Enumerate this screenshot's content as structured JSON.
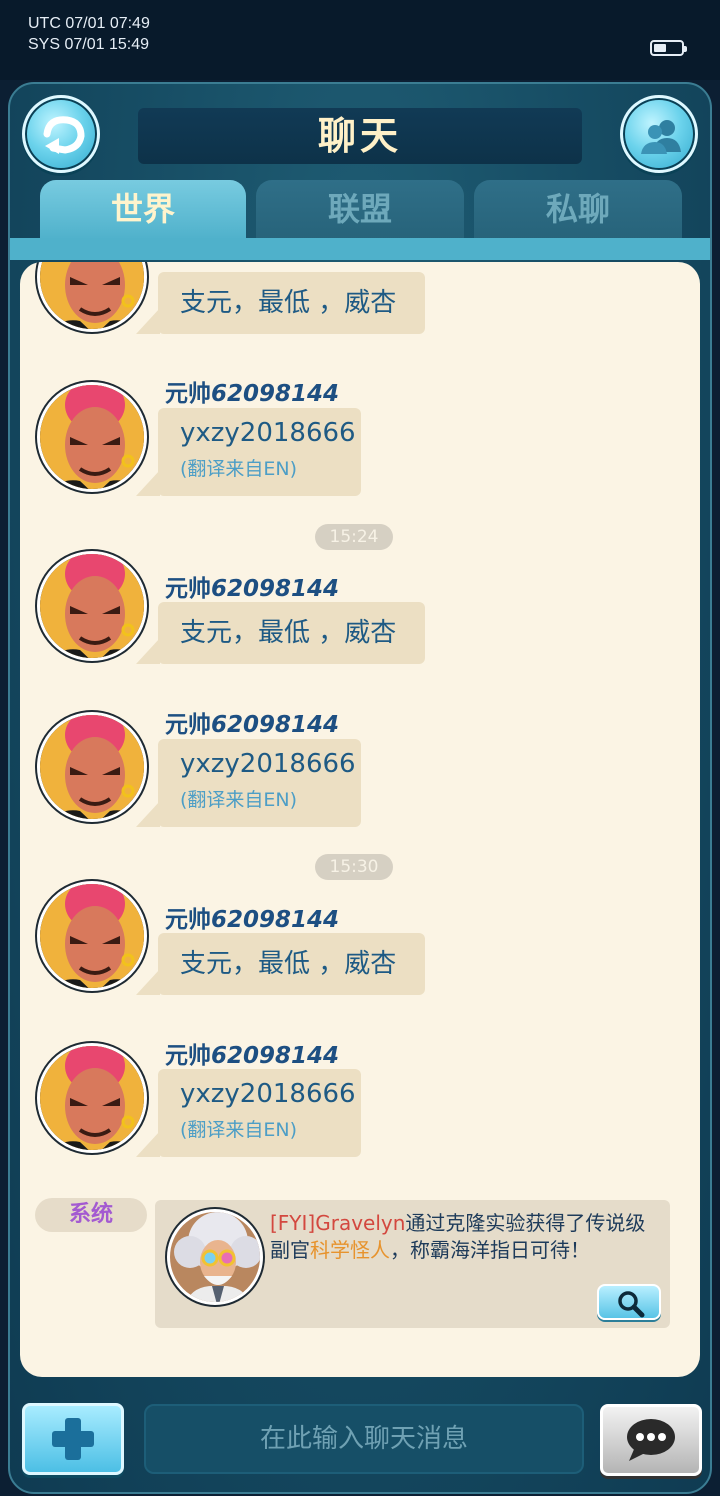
{
  "status_bar": {
    "utc": "UTC 07/01 07:49",
    "sys": "SYS 07/01 15:49",
    "battery_level": 0.45
  },
  "header": {
    "title": "聊天",
    "back_icon": "return-arrow-icon",
    "friends_icon": "friends-icon"
  },
  "tabs": [
    {
      "label": "世界",
      "active": true
    },
    {
      "label": "联盟",
      "active": false
    },
    {
      "label": "私聊",
      "active": false
    }
  ],
  "messages": [
    {
      "sender_prefix": "",
      "sender_id": "",
      "text": "支元，最低 ，威杏",
      "translation": ""
    },
    {
      "sender_prefix": "元帅",
      "sender_id": "62098144",
      "text": "yxzy2018666",
      "translation": "(翻译来自EN)"
    },
    {
      "sender_prefix": "元帅",
      "sender_id": "62098144",
      "text": "支元，最低 ，威杏",
      "translation": ""
    },
    {
      "sender_prefix": "元帅",
      "sender_id": "62098144",
      "text": "yxzy2018666",
      "translation": "(翻译来自EN)"
    },
    {
      "sender_prefix": "元帅",
      "sender_id": "62098144",
      "text": "支元，最低 ，威杏",
      "translation": ""
    },
    {
      "sender_prefix": "元帅",
      "sender_id": "62098144",
      "text": "yxzy2018666",
      "translation": "(翻译来自EN)"
    }
  ],
  "timestamps": [
    "15:24",
    "15:30"
  ],
  "system_message": {
    "label": "系统",
    "part1": "[FYI]Gravelyn",
    "part2": "通过克隆实验获得了传说级副官",
    "part3": "科学怪人",
    "part4": "，称霸海洋指日可待！",
    "search_icon": "magnifier-icon"
  },
  "input": {
    "placeholder": "在此输入聊天消息",
    "plus_icon": "plus-icon",
    "send_icon": "chat-bubble-icon"
  },
  "colors": {
    "panel_bg": "#fbf4e4",
    "bubble_bg": "#ecdfc3",
    "sender_color": "#1d4f82",
    "system_label": "#a35ad1",
    "highlight_red": "#d3483f",
    "highlight_orange": "#e7932d"
  }
}
